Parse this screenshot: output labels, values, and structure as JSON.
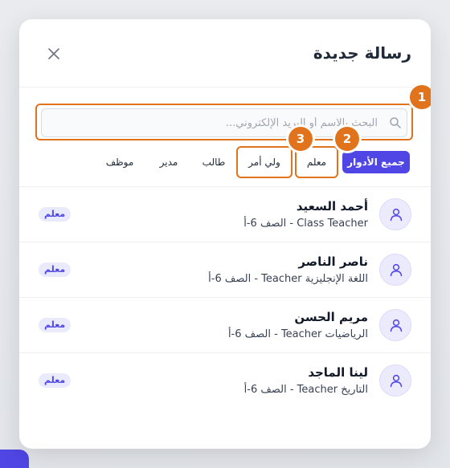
{
  "modal": {
    "title": "رسالة جديدة",
    "close_label": "×"
  },
  "search": {
    "placeholder": "البحث بالاسم أو البريد الإلكتروني..."
  },
  "annotations": [
    "1",
    "2",
    "3"
  ],
  "filters": [
    {
      "label": "جميع الأدوار",
      "active": true
    },
    {
      "label": "معلم",
      "active": false
    },
    {
      "label": "ولي أمر",
      "active": false
    },
    {
      "label": "طالب",
      "active": false
    },
    {
      "label": "مدير",
      "active": false
    },
    {
      "label": "موظف",
      "active": false
    }
  ],
  "contacts": [
    {
      "name": "أحمد السعيد",
      "subtitle": "Class Teacher - الصف 6-أ",
      "role": "معلم"
    },
    {
      "name": "ناصر الناصر",
      "subtitle": "اللغة الإنجليزية Teacher - الصف 6-أ",
      "role": "معلم"
    },
    {
      "name": "مريم الحسن",
      "subtitle": "الرياضيات Teacher - الصف 6-أ",
      "role": "معلم"
    },
    {
      "name": "لينا الماجد",
      "subtitle": "التاريخ Teacher - الصف 6-أ",
      "role": "معلم"
    }
  ],
  "colors": {
    "accent": "#4f46e5",
    "annotation": "#e2731d"
  }
}
